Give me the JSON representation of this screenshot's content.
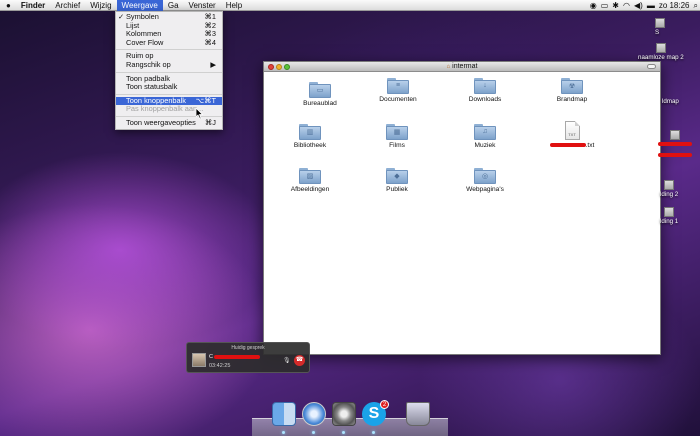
{
  "menubar": {
    "app": "Finder",
    "items": [
      "Archief",
      "Wijzig",
      "Weergave",
      "Ga",
      "Venster",
      "Help"
    ],
    "active": "Weergave",
    "clock": "zo 18:26"
  },
  "menu": {
    "items": [
      {
        "label": "Symbolen",
        "shortcut": "⌘1",
        "checked": "✓"
      },
      {
        "label": "Lijst",
        "shortcut": "⌘2"
      },
      {
        "label": "Kolommen",
        "shortcut": "⌘3"
      },
      {
        "label": "Cover Flow",
        "shortcut": "⌘4"
      },
      {
        "label": "Ruim op",
        "shortcut": ""
      },
      {
        "label": "Rangschik op",
        "shortcut": "▶"
      },
      {
        "label": "Toon padbalk",
        "shortcut": ""
      },
      {
        "label": "Toon statusbalk",
        "shortcut": ""
      },
      {
        "label": "Toon knoppenbalk",
        "shortcut": "⌥⌘T"
      },
      {
        "label": "Pas knoppenbalk aan...",
        "shortcut": ""
      },
      {
        "label": "Toon weergaveopties",
        "shortcut": "⌘J"
      }
    ]
  },
  "window": {
    "title": "intermat",
    "items": [
      {
        "label": "Bureaublad",
        "icon": "desktop-folder-icon",
        "glyph": "▭"
      },
      {
        "label": "Documenten",
        "icon": "documents-folder-icon",
        "glyph": "≡"
      },
      {
        "label": "Downloads",
        "icon": "downloads-folder-icon",
        "glyph": "↓"
      },
      {
        "label": "Brandmap",
        "icon": "burn-folder-icon",
        "glyph": "☢"
      },
      {
        "label": "Bibliotheek",
        "icon": "library-folder-icon",
        "glyph": "▥"
      },
      {
        "label": "Films",
        "icon": "movies-folder-icon",
        "glyph": "▦"
      },
      {
        "label": "Muziek",
        "icon": "music-folder-icon",
        "glyph": "♫"
      },
      {
        "label": ".txt",
        "icon": "text-document-icon",
        "ext": "TXT"
      },
      {
        "label": "Afbeeldingen",
        "icon": "pictures-folder-icon",
        "glyph": "▨"
      },
      {
        "label": "Publiek",
        "icon": "public-folder-icon",
        "glyph": "◆"
      },
      {
        "label": "Webpagina's",
        "icon": "sites-folder-icon",
        "glyph": "◎"
      }
    ]
  },
  "call": {
    "title": "Huidig gesprek",
    "name": "C",
    "time": "03:42:25"
  },
  "desktop": {
    "icons": [
      "naamloze map 2",
      "ldmap",
      "lding 2",
      "lding 1"
    ]
  },
  "dock": {
    "skype_badge": "2"
  }
}
